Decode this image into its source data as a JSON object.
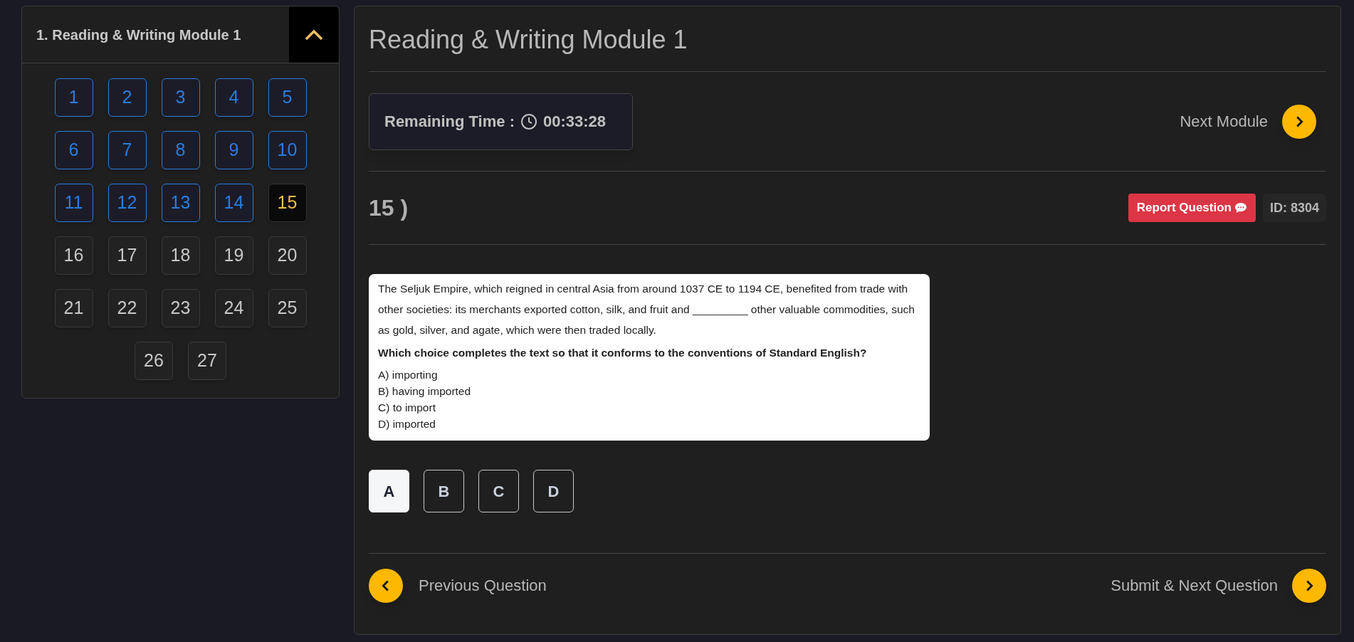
{
  "sidebar": {
    "title": "1. Reading & Writing Module 1",
    "expanded": true,
    "questions": [
      {
        "label": "1",
        "answered": true,
        "selected": false
      },
      {
        "label": "2",
        "answered": true,
        "selected": false
      },
      {
        "label": "3",
        "answered": true,
        "selected": false
      },
      {
        "label": "4",
        "answered": true,
        "selected": false
      },
      {
        "label": "5",
        "answered": true,
        "selected": false
      },
      {
        "label": "6",
        "answered": true,
        "selected": false
      },
      {
        "label": "7",
        "answered": true,
        "selected": false
      },
      {
        "label": "8",
        "answered": true,
        "selected": false
      },
      {
        "label": "9",
        "answered": true,
        "selected": false
      },
      {
        "label": "10",
        "answered": true,
        "selected": false
      },
      {
        "label": "11",
        "answered": true,
        "selected": false
      },
      {
        "label": "12",
        "answered": true,
        "selected": false
      },
      {
        "label": "13",
        "answered": true,
        "selected": false
      },
      {
        "label": "14",
        "answered": true,
        "selected": false
      },
      {
        "label": "15",
        "answered": false,
        "selected": true
      },
      {
        "label": "16",
        "answered": false,
        "selected": false
      },
      {
        "label": "17",
        "answered": false,
        "selected": false
      },
      {
        "label": "18",
        "answered": false,
        "selected": false
      },
      {
        "label": "19",
        "answered": false,
        "selected": false
      },
      {
        "label": "20",
        "answered": false,
        "selected": false
      },
      {
        "label": "21",
        "answered": false,
        "selected": false
      },
      {
        "label": "22",
        "answered": false,
        "selected": false
      },
      {
        "label": "23",
        "answered": false,
        "selected": false
      },
      {
        "label": "24",
        "answered": false,
        "selected": false
      },
      {
        "label": "25",
        "answered": false,
        "selected": false
      },
      {
        "label": "26",
        "answered": false,
        "selected": false
      },
      {
        "label": "27",
        "answered": false,
        "selected": false
      }
    ]
  },
  "main": {
    "title": "Reading & Writing Module 1",
    "timer": {
      "label": "Remaining Time :",
      "value": "00:33:28"
    },
    "next_module": "Next Module",
    "question_number": "15 )",
    "report_button": "Report Question",
    "question_id": "ID: 8304",
    "passage": "The Seljuk Empire, which reigned in central Asia from around 1037 CE to 1194 CE, benefited from trade with other societies: its merchants exported cotton, silk, and fruit and _________ other valuable commodities, such as gold, silver, and agate, which were then traded locally.",
    "prompt": "Which choice completes the text so that it conforms to the conventions of Standard English?",
    "choices": [
      "A) importing",
      "B) having imported",
      "C) to import",
      "D) imported"
    ],
    "answers": [
      {
        "label": "A",
        "selected": true
      },
      {
        "label": "B",
        "selected": false
      },
      {
        "label": "C",
        "selected": false
      },
      {
        "label": "D",
        "selected": false
      }
    ],
    "previous": "Previous Question",
    "submit_next": "Submit & Next Question"
  }
}
